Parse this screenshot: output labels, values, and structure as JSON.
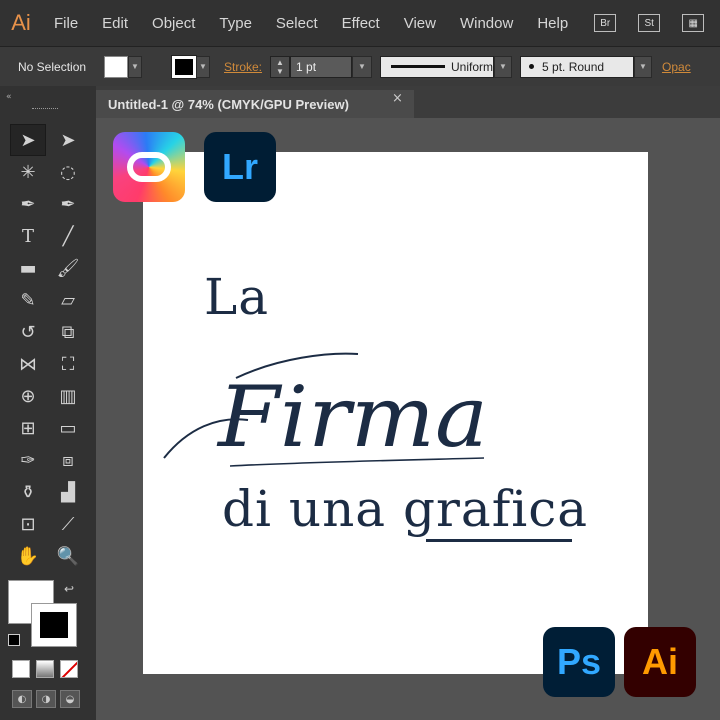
{
  "app": {
    "logo": "Ai"
  },
  "menu": {
    "items": [
      "File",
      "Edit",
      "Object",
      "Type",
      "Select",
      "Effect",
      "View",
      "Window",
      "Help"
    ],
    "bridge_label": "Br",
    "stock_label": "St"
  },
  "controlbar": {
    "selection_status": "No Selection",
    "stroke_label": "Stroke:",
    "stroke_weight": "1 pt",
    "profile_label": "Uniform",
    "brush_label": "5 pt. Round",
    "opacity_label": "Opac"
  },
  "document": {
    "tab_title": "Untitled-1 @ 74% (CMYK/GPU Preview)",
    "close_glyph": "×"
  },
  "artwork": {
    "line1": "La",
    "script_word": "Firma",
    "line3": "di una grafica",
    "text_color": "#1c2c44"
  },
  "badges": {
    "creative_cloud": "creative-cloud-icon",
    "lightroom": "Lr",
    "photoshop": "Ps",
    "illustrator": "Ai"
  },
  "colors": {
    "menubar": "#323232",
    "canvas_bg": "#535353",
    "accent_orange": "#d08a3a"
  }
}
